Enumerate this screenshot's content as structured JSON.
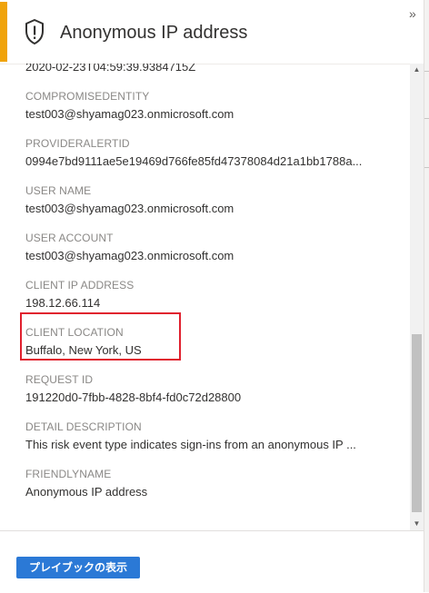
{
  "header": {
    "title": "Anonymous IP address",
    "icon": "shield-alert-icon",
    "collapse_glyph": "»",
    "accent_color": "#f0a30a"
  },
  "details": [
    {
      "label": "",
      "value": "2020-02-23T04:59:39.9384715Z"
    },
    {
      "label": "COMPROMISEDENTITY",
      "value": "test003@shyamag023.onmicrosoft.com"
    },
    {
      "label": "PROVIDERALERTID",
      "value": "0994e7bd9111ae5e19469d766fe85fd47378084d21a1bb1788a..."
    },
    {
      "label": "USER NAME",
      "value": "test003@shyamag023.onmicrosoft.com"
    },
    {
      "label": "USER ACCOUNT",
      "value": "test003@shyamag023.onmicrosoft.com"
    },
    {
      "label": "CLIENT IP ADDRESS",
      "value": "198.12.66.114"
    },
    {
      "label": "CLIENT LOCATION",
      "value": "Buffalo, New York, US"
    },
    {
      "label": "REQUEST ID",
      "value": "191220d0-7fbb-4828-8bf4-fd0c72d28800"
    },
    {
      "label": "DETAIL DESCRIPTION",
      "value": "This risk event type indicates sign-ins from an anonymous IP ..."
    },
    {
      "label": "FRIENDLYNAME",
      "value": "Anonymous IP address"
    }
  ],
  "highlight_color": "#e0202e",
  "footer": {
    "button_label": "プレイブックの表示",
    "button_color": "#2b79d6"
  },
  "scrollbar": {
    "up_glyph": "▲",
    "down_glyph": "▼"
  }
}
